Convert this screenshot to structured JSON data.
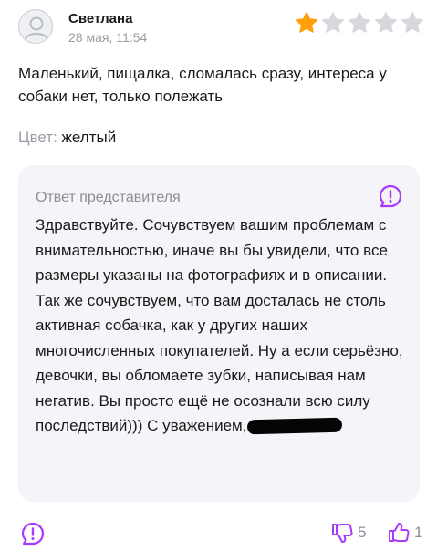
{
  "review": {
    "author": "Светлана",
    "date": "28 мая, 11:54",
    "rating": 1,
    "max_rating": 5,
    "text": "Маленький, пищалка, сломалась сразу, интереса у собаки нет, только полежать",
    "color_label": "Цвет: ",
    "color_value": "желтый"
  },
  "reply": {
    "title": "Ответ представителя",
    "text": "Здравствуйте. Сочувствуем вашим проблемам с внимательностью, иначе вы бы увидели, что все размеры указаны на фотографиях и в описании. Так же сочувствуем, что вам досталась не столь активная собачка, как у других наших многочисленных покупателей. Ну а если серьёзно, девочки, вы обломаете зубки, написывая нам негатив. Вы просто ещё не осознали всю  силу последствий))) С уважением,"
  },
  "footer": {
    "dislike_count": "5",
    "like_count": "1"
  },
  "icons": {
    "avatar": "user-avatar-icon",
    "star_filled": "star-filled-icon",
    "star_empty": "star-empty-icon",
    "report": "exclamation-bubble-icon",
    "dislike": "thumbs-down-icon",
    "like": "thumbs-up-icon"
  },
  "colors": {
    "accent": "#a73afd",
    "star_filled": "#ff9f0a",
    "star_empty": "#d6d8dd",
    "card_background": "#f5f4f8",
    "muted_text": "#9a9da4"
  }
}
